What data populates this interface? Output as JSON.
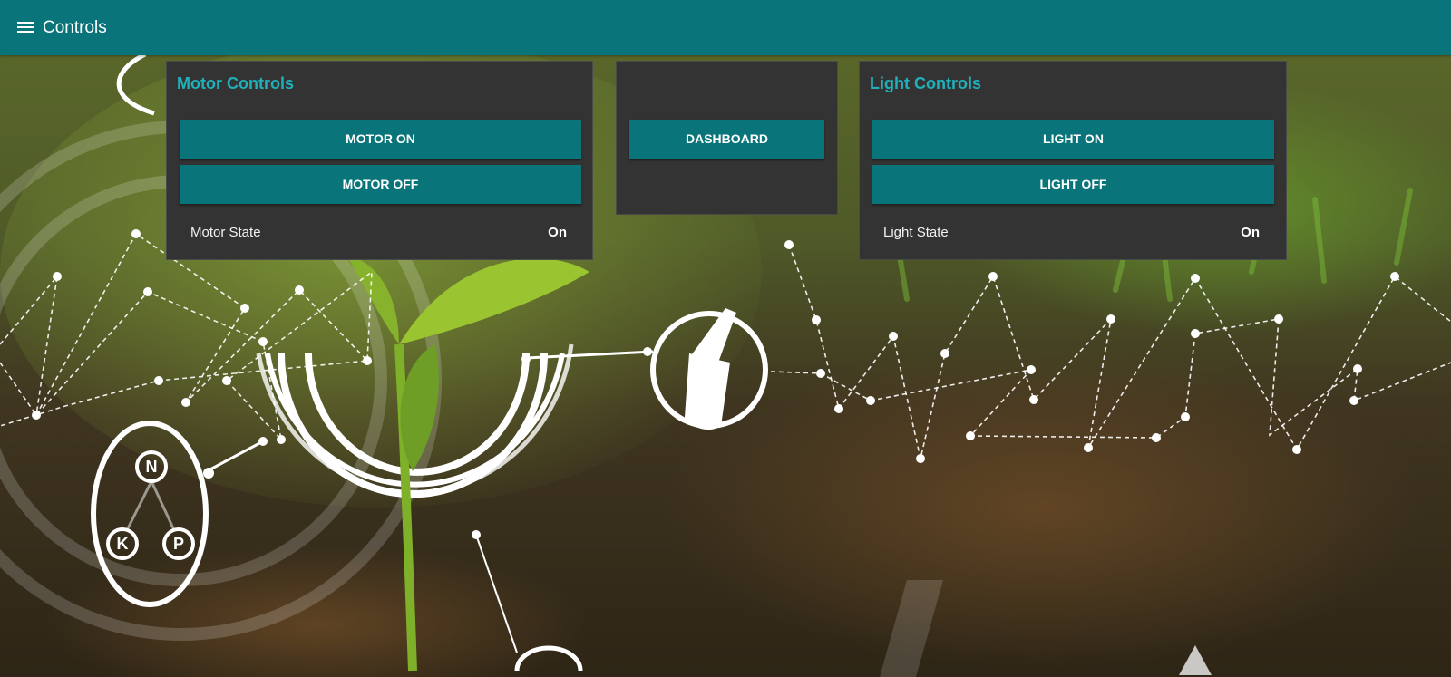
{
  "header": {
    "title": "Controls",
    "menu_icon": "hamburger-menu-icon",
    "background_color": "#097479"
  },
  "motor_card": {
    "title": "Motor Controls",
    "on_button": "MOTOR ON",
    "off_button": "MOTOR OFF",
    "state_label": "Motor State",
    "state_value": "On"
  },
  "nav_card": {
    "dashboard_button": "DASHBOARD"
  },
  "light_card": {
    "title": "Light Controls",
    "on_button": "LIGHT ON",
    "off_button": "LIGHT OFF",
    "state_label": "Light State",
    "state_value": "On"
  },
  "background": {
    "npk_letters": [
      "N",
      "K",
      "P"
    ]
  },
  "colors": {
    "accent": "#097479",
    "title_accent": "#1fb0ba",
    "card_background": "#333333"
  }
}
